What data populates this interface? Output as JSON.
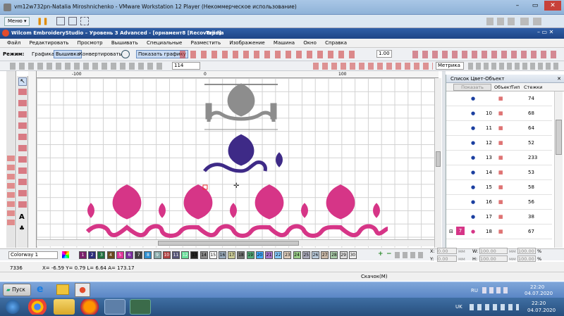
{
  "vm_window": {
    "title": "vm12w732pn-Natalia Miroshnichenko - VMware Workstation 12 Player (Некоммерческое использование)",
    "menu_label": "Меню"
  },
  "app": {
    "title": "Wilcom EmbroideryStudio – Уровень 3 Advanced - [орнамент8 [Recovered]",
    "title_extra": "Tajima"
  },
  "menu": [
    "Файл",
    "Редактировать",
    "Просмотр",
    "Вышивать",
    "Специальные",
    "Разместить",
    "Изображение",
    "Машина",
    "Окно",
    "Справка"
  ],
  "mode_bar": {
    "label": "Режим:",
    "tabs": [
      "Графика",
      "Вышивка",
      "Конвертировать"
    ],
    "show_graphics": "Показать графику",
    "zoom_value": "1.00"
  },
  "toolbar": {
    "zoom_value": "114",
    "units": "Метрика"
  },
  "ruler": {
    "marks": [
      "-100",
      "0",
      "100"
    ]
  },
  "panel": {
    "title": "Список Цвет-Объект",
    "show_button": "Показать",
    "col_object": "Объект",
    "col_type": "Тип",
    "col_stitches": "Стежки",
    "rows": [
      {
        "n": "",
        "stitches": "74"
      },
      {
        "n": "10",
        "stitches": "68"
      },
      {
        "n": "11",
        "stitches": "64"
      },
      {
        "n": "12",
        "stitches": "52"
      },
      {
        "n": "13",
        "stitches": "233"
      },
      {
        "n": "14",
        "stitches": "53"
      },
      {
        "n": "15",
        "stitches": "58"
      },
      {
        "n": "16",
        "stitches": "56"
      },
      {
        "n": "17",
        "stitches": "38"
      },
      {
        "n": "18",
        "stitches": "67"
      }
    ],
    "group_badge": "7"
  },
  "colorway": {
    "label": "Colorway 1",
    "swatches": [
      "1",
      "2",
      "3",
      "4",
      "5",
      "6",
      "7",
      "8",
      "9",
      "10",
      "11",
      "12",
      "13",
      "14",
      "15",
      "16",
      "17",
      "18",
      "19",
      "20",
      "21",
      "22",
      "23",
      "24",
      "25",
      "26",
      "27",
      "28",
      "29",
      "30"
    ]
  },
  "transform": {
    "x_label": "X:",
    "x_value": "0.00",
    "y_label": "Y:",
    "y_value": "0.00",
    "w_label": "W:",
    "w_value": "100.00",
    "h_label": "H:",
    "h_value": "100.00",
    "unit": "мм",
    "pct": "%"
  },
  "status": {
    "stitch_count": "7336",
    "coords": "X= -6.59 Y= 0.79 L= 6.64 A= 173.17",
    "scale_label": "Скачок(M)"
  },
  "xp_taskbar": {
    "start": "Пуск",
    "lang": "RU",
    "time": "22:20",
    "date": "04.07.2020"
  },
  "win7_taskbar": {
    "lang": "UK",
    "time": "22:20",
    "date": "04.07.2020"
  },
  "colors": {
    "gray": "#8d8d8d",
    "purple": "#3e2a87",
    "pink": "#d63587",
    "accent": "#1e4586"
  }
}
